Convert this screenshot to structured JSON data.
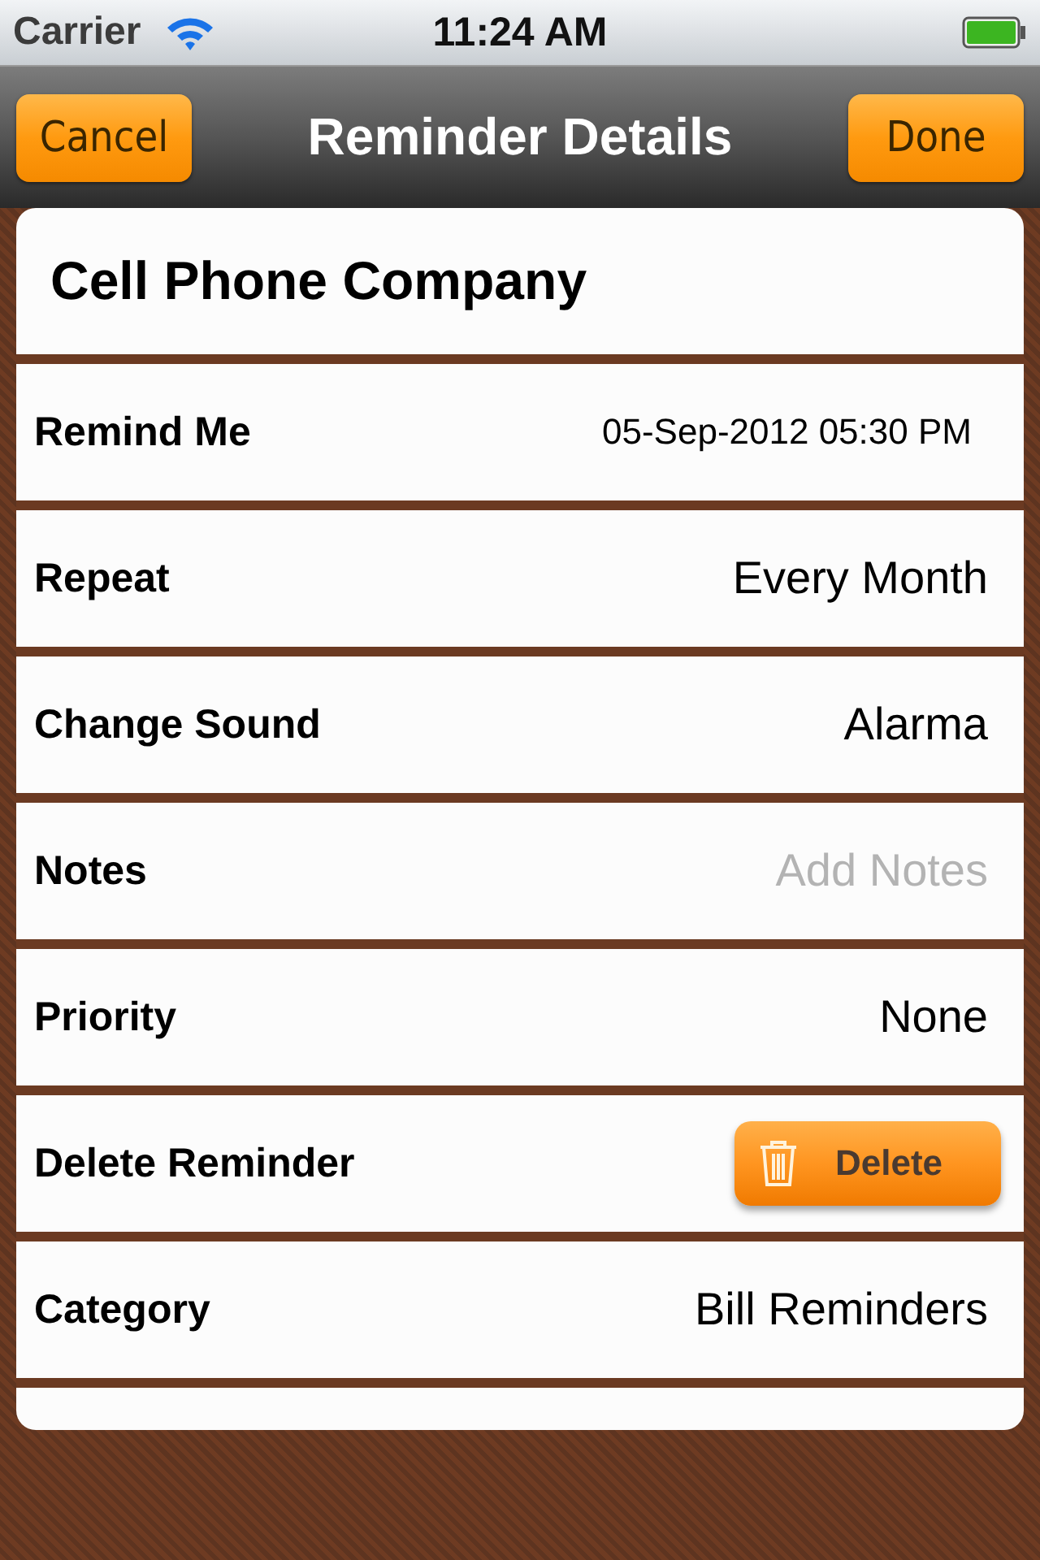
{
  "status_bar": {
    "carrier": "Carrier",
    "time": "11:24 AM"
  },
  "nav_bar": {
    "title": "Reminder Details",
    "left_button": "Cancel",
    "right_button": "Done"
  },
  "reminder_title": "Cell Phone Company",
  "rows": [
    {
      "label": "Remind Me",
      "kind": "date",
      "value": "05-Sep-2012 05:30 PM"
    },
    {
      "label": "Repeat",
      "kind": "value",
      "value": "Every Month"
    },
    {
      "label": "Change Sound",
      "kind": "value",
      "value": "Alarma"
    },
    {
      "label": "Notes",
      "kind": "placeholder",
      "placeholder": "Add Notes"
    },
    {
      "label": "Priority",
      "kind": "value",
      "value": "None"
    },
    {
      "label": "Delete Reminder",
      "kind": "button",
      "button": "Delete"
    },
    {
      "label": "Category",
      "kind": "value",
      "value": "Bill Reminders"
    }
  ]
}
